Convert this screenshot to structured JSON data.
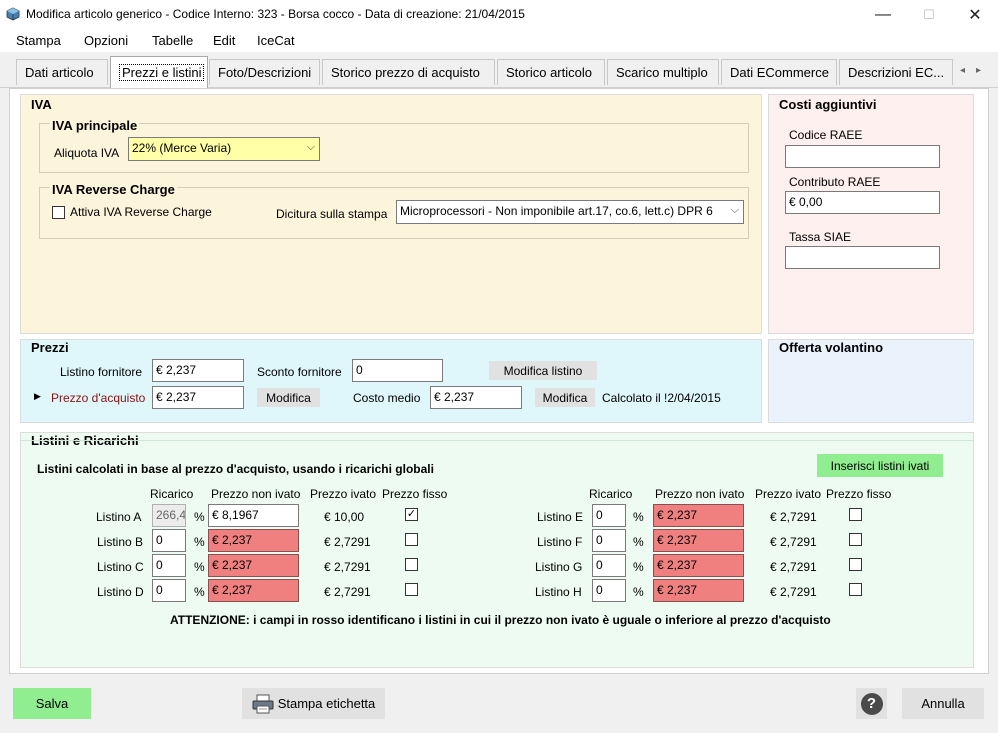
{
  "window": {
    "title": "Modifica articolo generico - Codice Interno: 323 - Borsa cocco - Data di creazione: 21/04/2015",
    "icon": "package-icon",
    "minimize": "—",
    "maximize": "☐",
    "close": "✕"
  },
  "menu": [
    "Stampa",
    "Opzioni",
    "Tabelle",
    "Edit",
    "IceCat"
  ],
  "tabs": [
    "Dati articolo",
    "Prezzi e listini",
    "Foto/Descrizioni",
    "Storico prezzo di acquisto",
    "Storico articolo",
    "Scarico multiplo",
    "Dati ECommerce",
    "Descrizioni EC..."
  ],
  "tab_nav": {
    "prev": "◂",
    "next": "▸"
  },
  "iva": {
    "title": "IVA",
    "principale_title": "IVA principale",
    "aliquota_label": "Aliquota IVA",
    "aliquota_value": "22% (Merce Varia)",
    "reverse_title": "IVA Reverse Charge",
    "reverse_checkbox_label": "Attiva IVA Reverse Charge",
    "dicitura_label": "Dicitura sulla stampa",
    "dicitura_value": "Microprocessori - Non imponibile art.17, co.6, lett.c) DPR 6"
  },
  "costi": {
    "title": "Costi aggiuntivi",
    "raee_label": "Codice RAEE",
    "raee_value": "",
    "contributo_label": "Contributo RAEE",
    "contributo_value": "€ 0,00",
    "siae_label": "Tassa SIAE",
    "siae_value": ""
  },
  "prezzi": {
    "title": "Prezzi",
    "listino_fornitore_label": "Listino fornitore",
    "listino_fornitore_value": "€ 2,237",
    "sconto_label": "Sconto fornitore",
    "sconto_value": "0",
    "modifica_listino": "Modifica listino",
    "row_marker": "▶",
    "acquisto_label": "Prezzo d'acquisto",
    "acquisto_value": "€ 2,237",
    "modifica": "Modifica",
    "costo_medio_label": "Costo medio",
    "costo_medio_value": "€ 2,237",
    "calcolato": "Calcolato il  !2/04/2015"
  },
  "offerta": {
    "title": "Offerta volantino"
  },
  "listini": {
    "title": "Listini e Ricarichi",
    "subtitle": "Listini calcolati in base al prezzo d'acquisto, usando i ricarichi globali",
    "inserisci_button": "Inserisci listini ivati",
    "headers": {
      "ricarico": "Ricarico",
      "non_ivato": "Prezzo non ivato",
      "ivato": "Prezzo ivato",
      "fisso": "Prezzo fisso"
    },
    "percent": "%",
    "left": [
      {
        "name": "Listino A",
        "ricarico": "266,4",
        "non_ivato": "€ 8,1967",
        "ivato": "€ 10,00",
        "fisso": true,
        "red": false
      },
      {
        "name": "Listino B",
        "ricarico": "0",
        "non_ivato": "€ 2,237",
        "ivato": "€ 2,7291",
        "fisso": false,
        "red": true
      },
      {
        "name": "Listino C",
        "ricarico": "0",
        "non_ivato": "€ 2,237",
        "ivato": "€ 2,7291",
        "fisso": false,
        "red": true
      },
      {
        "name": "Listino D",
        "ricarico": "0",
        "non_ivato": "€ 2,237",
        "ivato": "€ 2,7291",
        "fisso": false,
        "red": true
      }
    ],
    "right": [
      {
        "name": "Listino E",
        "ricarico": "0",
        "non_ivato": "€ 2,237",
        "ivato": "€ 2,7291",
        "fisso": false,
        "red": true
      },
      {
        "name": "Listino F",
        "ricarico": "0",
        "non_ivato": "€ 2,237",
        "ivato": "€ 2,7291",
        "fisso": false,
        "red": true
      },
      {
        "name": "Listino G",
        "ricarico": "0",
        "non_ivato": "€ 2,237",
        "ivato": "€ 2,7291",
        "fisso": false,
        "red": true
      },
      {
        "name": "Listino H",
        "ricarico": "0",
        "non_ivato": "€ 2,237",
        "ivato": "€ 2,7291",
        "fisso": false,
        "red": true
      }
    ],
    "warning": "ATTENZIONE: i campi in rosso identificano i listini in cui il prezzo non ivato è uguale o inferiore al prezzo d'acquisto"
  },
  "footer": {
    "salva": "Salva",
    "stampa_etichetta": "Stampa etichetta",
    "help": "?",
    "annulla": "Annulla"
  },
  "colors": {
    "iva_panel": "#fdf4dc",
    "costi_panel": "#fdf0ee",
    "prezzi_panel": "#dff7fb",
    "offerta_panel": "#eaf3fb",
    "listini_panel": "#eefbf3",
    "red_field": "#f08080",
    "green_button": "#90ee90"
  }
}
